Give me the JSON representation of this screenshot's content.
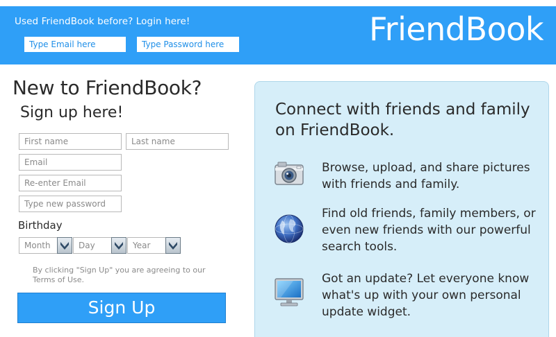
{
  "header": {
    "login_prompt": "Used FriendBook before? Login here!",
    "email_placeholder": "Type Email here",
    "password_placeholder": "Type Password here",
    "brand": "FriendBook"
  },
  "signup": {
    "title": "New to FriendBook?",
    "subtitle": "Sign up here!",
    "first_name_placeholder": "First name",
    "last_name_placeholder": "Last name",
    "email_placeholder": "Email",
    "reenter_email_placeholder": "Re-enter Email",
    "password_placeholder": "Type new password",
    "birthday_label": "Birthday",
    "month_value": "Month",
    "day_value": "Day",
    "year_value": "Year",
    "terms": "By clicking \"Sign Up\" you are agreeing to our Terms of Use.",
    "button_label": "Sign Up"
  },
  "info": {
    "heading": "Connect with friends and family on FriendBook.",
    "features": [
      {
        "icon": "camera-icon",
        "text": "Browse, upload, and share pictures with friends and family."
      },
      {
        "icon": "globe-icon",
        "text": "Find old friends, family members, or even new friends with our powerful search tools."
      },
      {
        "icon": "monitor-icon",
        "text": "Got an update? Let everyone know what's up with your own personal update widget."
      }
    ]
  },
  "colors": {
    "brand_blue": "#2f9ff7",
    "panel_bg": "#d6eef9"
  }
}
